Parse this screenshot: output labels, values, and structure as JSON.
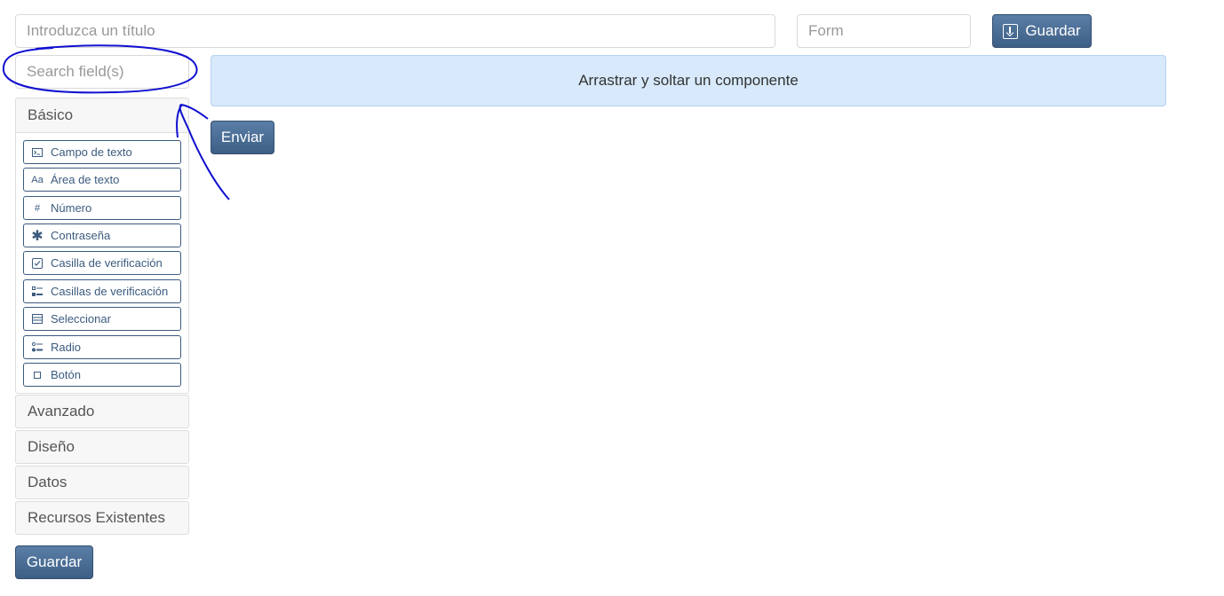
{
  "header": {
    "title_placeholder": "Introduzca un título",
    "type_value": "Form",
    "save_label": "Guardar"
  },
  "sidebar": {
    "search_placeholder": "Search field(s)",
    "groups": [
      {
        "label": "Básico",
        "items": [
          {
            "label": "Campo de texto",
            "icon": "terminal-icon"
          },
          {
            "label": "Área de texto",
            "icon": "font-icon"
          },
          {
            "label": "Número",
            "icon": "hashtag-icon"
          },
          {
            "label": "Contraseña",
            "icon": "asterisk-icon"
          },
          {
            "label": "Casilla de verificación",
            "icon": "check-square-icon"
          },
          {
            "label": "Casillas de verificación",
            "icon": "list-icon"
          },
          {
            "label": "Seleccionar",
            "icon": "select-list-icon"
          },
          {
            "label": "Radio",
            "icon": "radio-list-icon"
          },
          {
            "label": "Botón",
            "icon": "stop-icon"
          }
        ]
      },
      {
        "label": "Avanzado"
      },
      {
        "label": "Diseño"
      },
      {
        "label": "Datos"
      },
      {
        "label": "Recursos Existentes"
      }
    ]
  },
  "builder": {
    "dropzone_text": "Arrastrar y soltar un componente",
    "submit_label": "Enviar"
  },
  "footer": {
    "save_label": "Guardar"
  },
  "colors": {
    "primary": "#4a6d94",
    "dropzone_bg": "#d7e9fb",
    "annotation": "#1010d0"
  }
}
